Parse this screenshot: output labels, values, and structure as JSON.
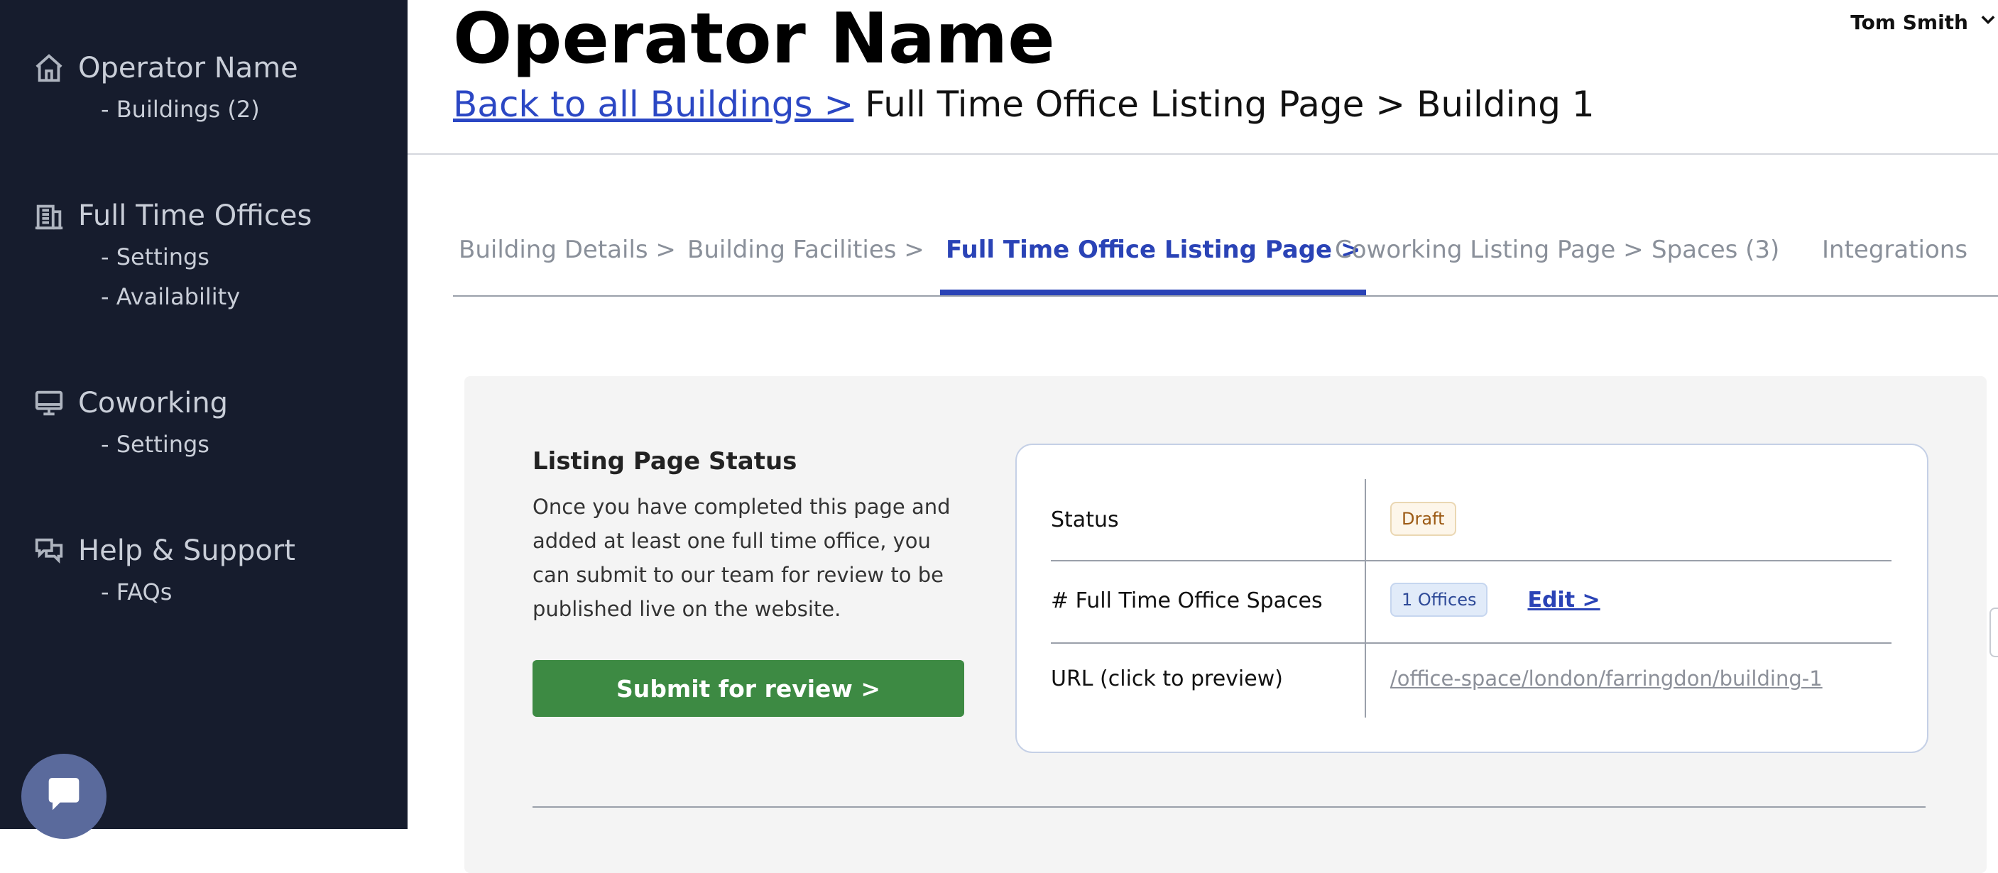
{
  "sidebar": {
    "groups": [
      {
        "title": "Operator Name",
        "icon": "home-icon",
        "items": [
          "- Buildings (2)"
        ]
      },
      {
        "title": "Full Time Offices",
        "icon": "office-building-icon",
        "items": [
          "- Settings",
          "- Availability"
        ]
      },
      {
        "title": "Coworking",
        "icon": "monitor-icon",
        "items": [
          "- Settings"
        ]
      },
      {
        "title": "Help & Support",
        "icon": "chat-bubbles-icon",
        "items": [
          "- FAQs"
        ]
      }
    ],
    "chat_button_icon": "chat-icon"
  },
  "header": {
    "title": "Operator Name",
    "breadcrumb_link": "Back to all Buildings >",
    "breadcrumb_rest": "Full Time Office Listing Page > Building 1",
    "user_name": "Tom Smith"
  },
  "tabs": [
    {
      "label": "Building Details >",
      "active": false
    },
    {
      "label": "Building Facilities >",
      "active": false
    },
    {
      "label": "Full Time Office Listing Page >",
      "active": true
    },
    {
      "label": "Coworking Listing Page >",
      "active": false
    },
    {
      "label": "Spaces (3)",
      "active": false
    },
    {
      "label": "Integrations",
      "active": false
    }
  ],
  "listing_status": {
    "heading": "Listing Page Status",
    "description": "Once you have completed this page and added at least one full time office, you can submit to our team for review to be published live on the website.",
    "submit_label": "Submit for review >",
    "rows": {
      "status_label": "Status",
      "status_value": "Draft",
      "spaces_label": "# Full Time Office Spaces",
      "spaces_value": "1 Offices",
      "edit_label": "Edit >",
      "url_label": "URL (click to preview)",
      "url_value": "/office-space/london/farringdon/building-1"
    }
  },
  "colors": {
    "sidebar_bg": "#161c2d",
    "accent_blue": "#2a43b6",
    "submit_green": "#3d8a43"
  }
}
